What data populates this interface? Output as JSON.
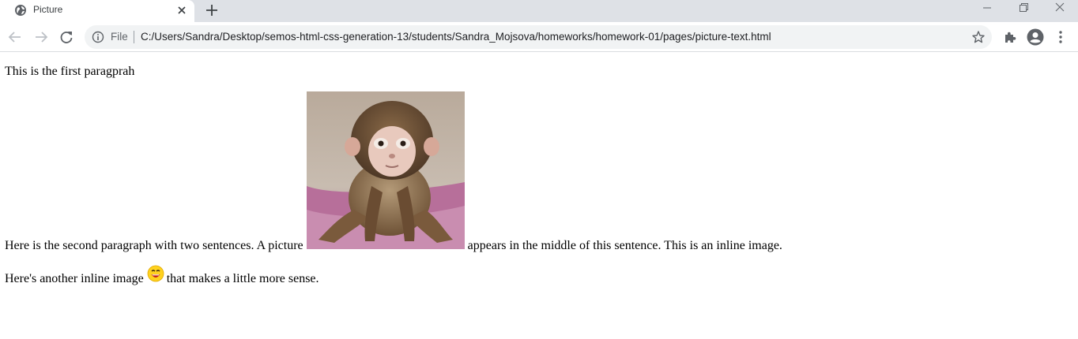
{
  "browser": {
    "tab_title": "Picture",
    "omnibox": {
      "scheme_label": "File",
      "url": "C:/Users/Sandra/Desktop/semos-html-css-generation-13/students/Sandra_Mojsova/homeworks/homework-01/pages/picture-text.html"
    },
    "icons": {
      "favicon": "globe-icon",
      "close": "close-icon",
      "new_tab": "plus-icon",
      "back": "back-arrow-icon",
      "forward": "forward-arrow-icon",
      "reload": "reload-icon",
      "info": "info-icon",
      "bookmark": "star-icon",
      "extensions": "puzzle-icon",
      "profile": "account-icon",
      "menu": "kebab-menu-icon"
    },
    "colors": {
      "tabstrip": "#dee1e6",
      "omnibox": "#f1f3f4",
      "icon": "#5f6368"
    }
  },
  "page": {
    "paragraph1": "This is the first paragprah",
    "paragraph2_before": "Here is the second paragraph with two sentences. A picture",
    "paragraph2_after": "appears in the middle of this sentence. This is an inline image.",
    "paragraph3_before": "Here's another inline image",
    "paragraph3_after": "that makes a little more sense."
  }
}
